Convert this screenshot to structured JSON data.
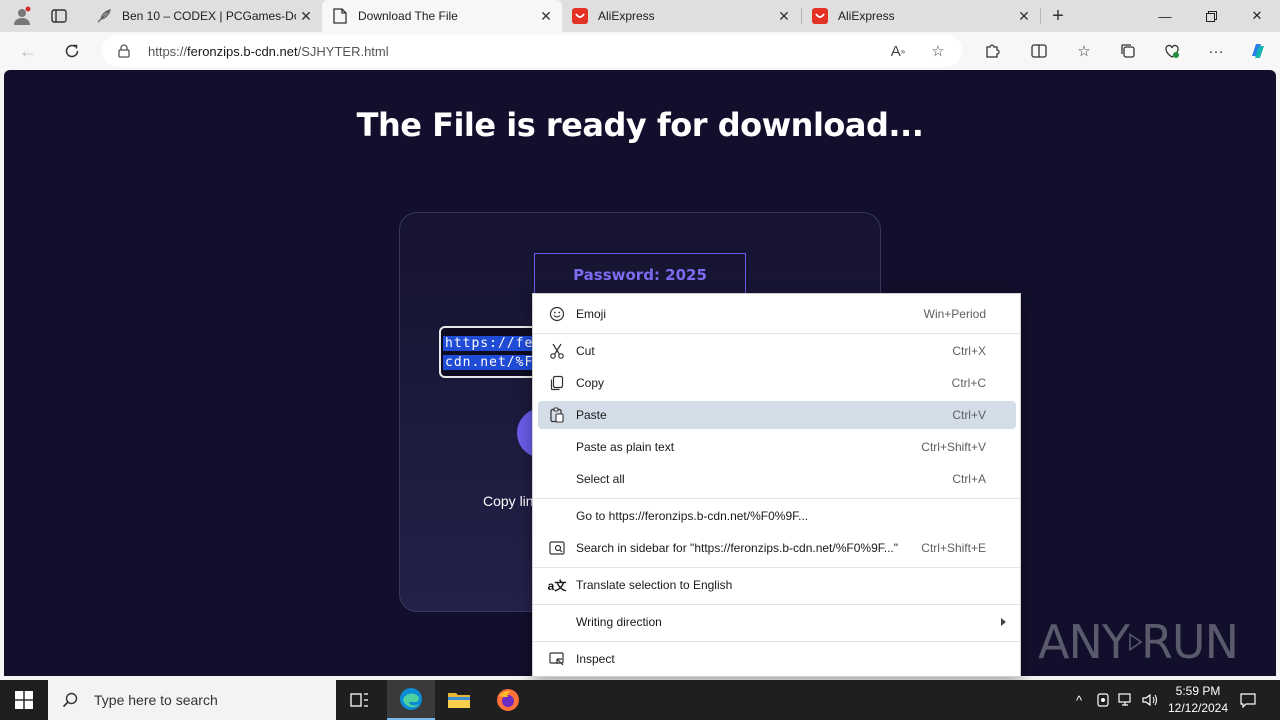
{
  "browser": {
    "tabs": [
      {
        "title": "Ben 10 – CODEX | PCGames-Dow",
        "active": false
      },
      {
        "title": "Download The File",
        "active": true
      },
      {
        "title": "AliExpress",
        "active": false
      },
      {
        "title": "AliExpress",
        "active": false
      }
    ],
    "url_prefix": "https://",
    "url_domain": "feronzips.b-cdn.net",
    "url_path": "/SJHYTER.html"
  },
  "page": {
    "title": "The File is ready for download...",
    "password_label": "Password: 2025",
    "link_line1": "https://fer",
    "link_line2": "cdn.net/%F0",
    "copy_label": "Copy lin",
    "watermark_left": "ANY",
    "watermark_right": "RUN"
  },
  "context_menu": {
    "items": [
      {
        "label": "Emoji",
        "shortcut": "Win+Period",
        "icon": "emoji-icon"
      },
      {
        "label": "Cut",
        "shortcut": "Ctrl+X",
        "icon": "scissors-icon"
      },
      {
        "label": "Copy",
        "shortcut": "Ctrl+C",
        "icon": "copy-icon"
      },
      {
        "label": "Paste",
        "shortcut": "Ctrl+V",
        "icon": "paste-icon",
        "highlighted": true
      },
      {
        "label": "Paste as plain text",
        "shortcut": "Ctrl+Shift+V"
      },
      {
        "label": "Select all",
        "shortcut": "Ctrl+A"
      },
      {
        "label": "Go to https://feronzips.b-cdn.net/%F0%9F...",
        "shortcut": ""
      },
      {
        "label": "Search in sidebar for \"https://feronzips.b-cdn.net/%F0%9F...\"",
        "shortcut": "Ctrl+Shift+E",
        "icon": "sidebar-search-icon"
      },
      {
        "label": "Translate selection to English",
        "shortcut": "",
        "icon": "translate-icon"
      },
      {
        "label": "Writing direction",
        "shortcut": "",
        "submenu": true
      },
      {
        "label": "Inspect",
        "shortcut": "",
        "icon": "inspect-icon"
      }
    ]
  },
  "taskbar": {
    "search_placeholder": "Type here to search",
    "time": "5:59 PM",
    "date": "12/12/2024"
  },
  "colors": {
    "page_bg": "#110f2b",
    "accent": "#6b5ce7",
    "highlight": "#d3dde8",
    "selection": "#1f4bd6"
  }
}
